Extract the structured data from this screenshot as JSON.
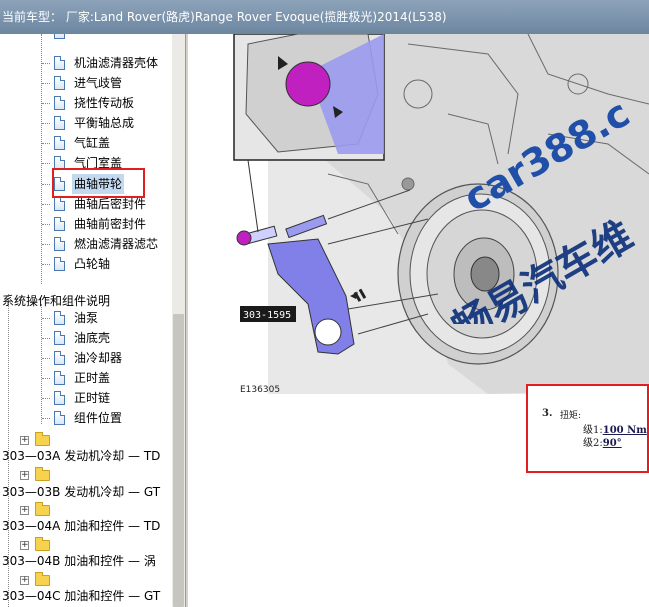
{
  "titlebar": {
    "text": "当前车型：   厂家:Land Rover(路虎)Range Rover Evoque(揽胜极光)2014(L538)"
  },
  "tree": {
    "items": [
      {
        "label": "机油滤清器壳体"
      },
      {
        "label": "进气歧管"
      },
      {
        "label": "挠性传动板"
      },
      {
        "label": "平衡轴总成"
      },
      {
        "label": "气缸盖"
      },
      {
        "label": "气门室盖"
      },
      {
        "label": "曲轴带轮"
      },
      {
        "label": "曲轴后密封件"
      },
      {
        "label": "曲轴前密封件"
      },
      {
        "label": "燃油滤清器滤芯"
      },
      {
        "label": "凸轮轴"
      }
    ],
    "section_label": "系统操作和组件说明",
    "section_items": [
      {
        "label": "油泵"
      },
      {
        "label": "油底壳"
      },
      {
        "label": "油冷却器"
      },
      {
        "label": "正时盖"
      },
      {
        "label": "正时链"
      },
      {
        "label": "组件位置"
      }
    ],
    "folders": [
      {
        "label": "303—03A 发动机冷却 — TD"
      },
      {
        "label": "303—03B 发动机冷却 — GT"
      },
      {
        "label": "303—04A 加油和控件 — TD"
      },
      {
        "label": "303—04B 加油和控件 — 涡"
      },
      {
        "label": "303—04C 加油和控件 — GT"
      }
    ]
  },
  "diagram": {
    "tool_label": "303-1595",
    "figure_id": "E136305",
    "watermark_site": "car388.c",
    "watermark_brand": "畅易汽车维"
  },
  "torque": {
    "step": "3.",
    "title": "扭矩:",
    "stage1_prefix": "级1:",
    "stage1_value": "100 Nm",
    "stage2_prefix": "级2:",
    "stage2_value": "90°"
  },
  "colors": {
    "highlight": "#e02020",
    "tool_purple": "#8080e8",
    "knob_magenta": "#c020c0"
  }
}
